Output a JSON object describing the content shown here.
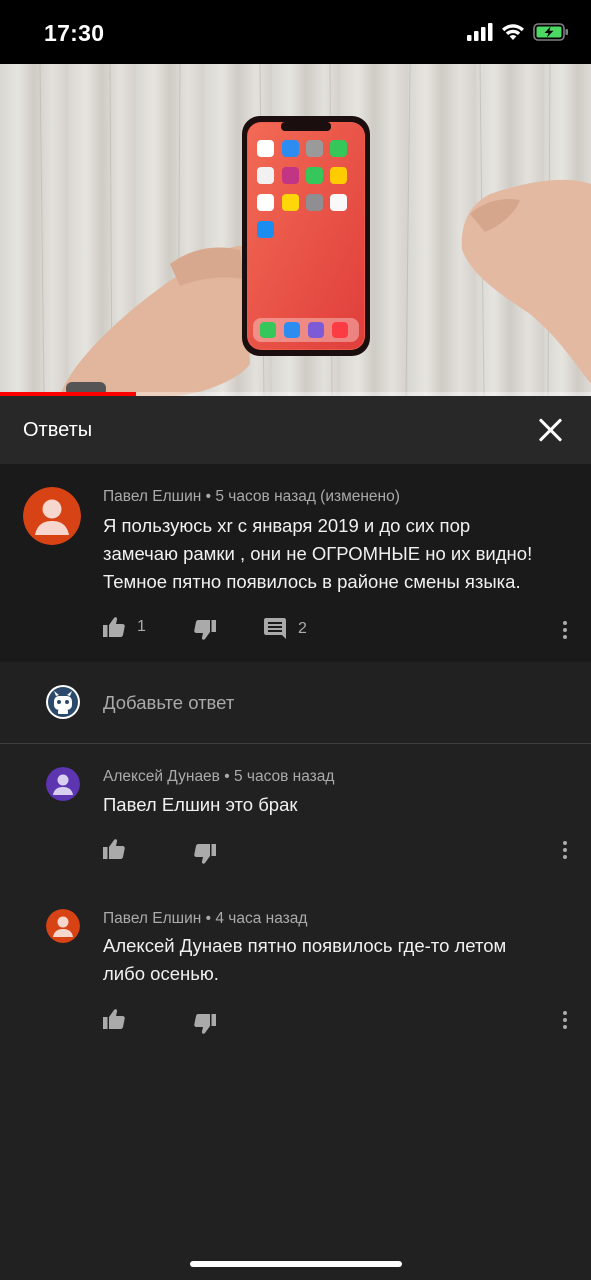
{
  "status_bar": {
    "time": "17:30"
  },
  "video": {
    "progress_percent": 23
  },
  "panel": {
    "title": "Ответы"
  },
  "parent_comment": {
    "author": "Павел Елшин",
    "time": "5 часов назад (изменено)",
    "text_lines": [
      "Я пользуюсь xr с января 2019 и до сих пор",
      "замечаю рамки , они не ОГРОМНЫЕ но их видно!",
      "Темное пятно появилось в районе смены языка."
    ],
    "likes": "1",
    "replies": "2",
    "avatar_color": "#d84315"
  },
  "add_reply": {
    "placeholder": "Добавьте ответ"
  },
  "replies": [
    {
      "author": "Алексей Дунаев",
      "time": "5 часов назад",
      "text_lines": [
        "Павел Елшин это брак"
      ],
      "avatar_color": "#5e35b1"
    },
    {
      "author": "Павел Елшин",
      "time": "4 часа назад",
      "text_lines": [
        "Алексей Дунаев пятно появилось где-то летом",
        "либо осенью."
      ],
      "avatar_color": "#d84315"
    }
  ],
  "icons": [
    "signal-icon",
    "wifi-icon",
    "battery-charging-icon",
    "close-icon",
    "thumbs-up-icon",
    "thumbs-down-icon",
    "reply-icon",
    "more-vertical-icon",
    "user-avatar-icon"
  ],
  "colors": {
    "accent": "#ff0000",
    "background": "#212121",
    "header": "#282828",
    "highlight_comment": "#1a1a1a"
  }
}
